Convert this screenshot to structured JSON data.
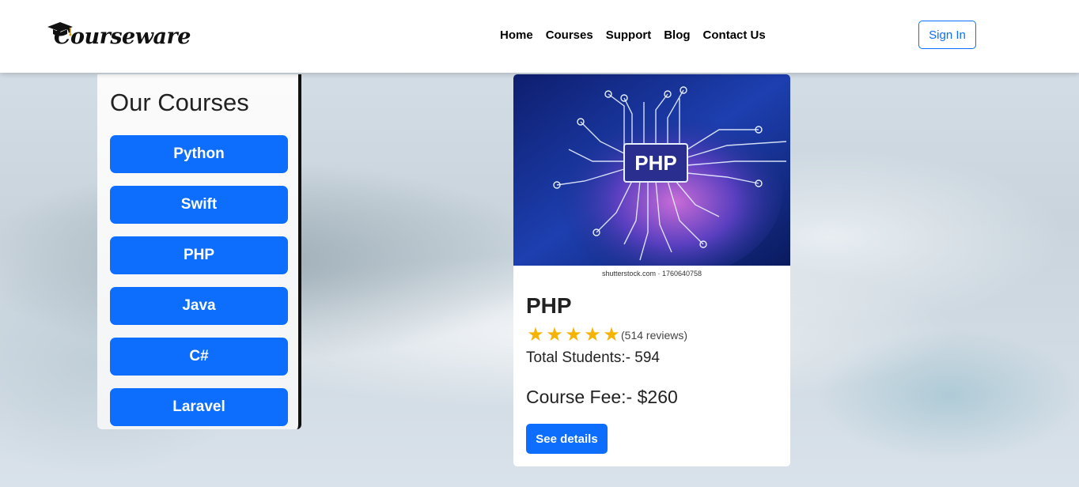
{
  "brand": {
    "name": "Courseware",
    "icon": "graduation-cap-icon"
  },
  "nav": {
    "links": [
      "Home",
      "Courses",
      "Support",
      "Blog",
      "Contact Us"
    ],
    "signin_label": "Sign In"
  },
  "sidebar": {
    "title": "Our Courses",
    "courses": [
      "Python",
      "Swift",
      "PHP",
      "Java",
      "C#",
      "Laravel"
    ]
  },
  "course_card": {
    "image_text": "PHP",
    "image_caption": "shutterstock.com · 1760640758",
    "title": "PHP",
    "rating": 5,
    "max_rating": 5,
    "reviews_text": "(514 reviews)",
    "students_text": "Total Students:- 594",
    "fee_text": "Course Fee:- $260",
    "details_label": "See details"
  },
  "colors": {
    "primary": "#0d6efd",
    "star": "#f5b301"
  }
}
